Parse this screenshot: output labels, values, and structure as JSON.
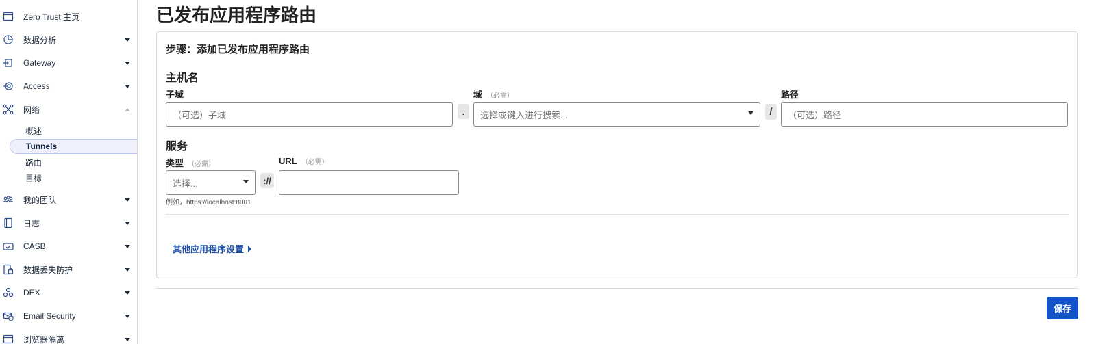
{
  "sidebar": {
    "items": [
      {
        "label": "Zero Trust 主页",
        "icon": "browser-window-icon"
      },
      {
        "label": "数据分析",
        "icon": "pie-chart-icon"
      },
      {
        "label": "Gateway",
        "icon": "gateway-icon"
      },
      {
        "label": "Access",
        "icon": "access-icon"
      },
      {
        "label": "网络",
        "icon": "network-icon"
      },
      {
        "label": "我的团队",
        "icon": "team-icon"
      },
      {
        "label": "日志",
        "icon": "log-book-icon"
      },
      {
        "label": "CASB",
        "icon": "casb-icon"
      },
      {
        "label": "数据丢失防护",
        "icon": "dlp-icon"
      },
      {
        "label": "DEX",
        "icon": "dex-icon"
      },
      {
        "label": "Email Security",
        "icon": "email-security-icon"
      },
      {
        "label": "浏览器隔离",
        "icon": "browser-isolation-icon"
      }
    ],
    "network_sub": [
      {
        "label": "概述"
      },
      {
        "label": "Tunnels",
        "active": true
      },
      {
        "label": "路由"
      },
      {
        "label": "目标"
      }
    ]
  },
  "main": {
    "page_title": "已发布应用程序路由",
    "step_title": "步骤：添加已发布应用程序路由",
    "hostname": {
      "section": "主机名",
      "subdomain_label": "子域",
      "subdomain_placeholder": "（可选）子域",
      "domain_label": "域",
      "domain_required": "（必需）",
      "domain_placeholder": "选择或键入进行搜索...",
      "dot_sep": ".",
      "path_label": "路径",
      "path_placeholder": "（可选）路径",
      "slash_sep": "/"
    },
    "service": {
      "section": "服务",
      "type_label": "类型",
      "type_required": "（必需）",
      "type_placeholder": "选择...",
      "scheme_sep": "://",
      "url_label": "URL",
      "url_required": "（必需）",
      "url_value": "",
      "hint": "例如，https://localhost:8001"
    },
    "advanced_link": "其他应用程序设置",
    "save_label": "保存"
  },
  "colors": {
    "accent": "#1554c7",
    "link": "#1d4ea8",
    "active_nav_bg": "#eef1fb"
  }
}
